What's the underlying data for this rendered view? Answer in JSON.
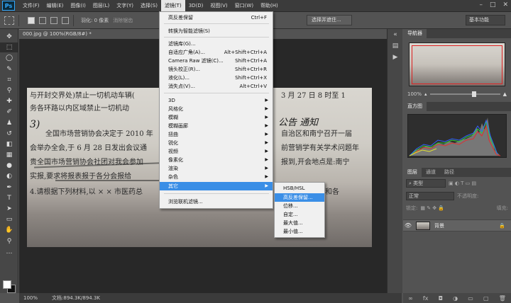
{
  "app": {
    "logo": "Ps"
  },
  "menubar": [
    "文件(F)",
    "编辑(E)",
    "图像(I)",
    "图层(L)",
    "文字(Y)",
    "选择(S)",
    "滤镜(T)",
    "3D(D)",
    "视图(V)",
    "窗口(W)",
    "帮助(H)"
  ],
  "options": {
    "feather": "羽化: 0 像素",
    "anti_alias": "消除锯齿",
    "select_and_mask": "选择并遮住...",
    "workspace": "基本功能"
  },
  "document": {
    "tab_title": "000.jpg @ 100%(RGB/8#) *",
    "zoom": "100%",
    "doc_info": "文档:894.3K/894.3K"
  },
  "canvas_text": {
    "l1": "与开封交界处)禁止一切机动车辆(",
    "l2": "务各环路以内区域禁止一切机动",
    "l3": "全国市场营销协会决定于 2010 年",
    "l4": "会举办全会,于 6 月 28 日发出会议通",
    "l5": "贵全国市场营销协会社团对我会参加",
    "l6": "实报,要求将报表报于各分会报给",
    "l7": "4.请根据下列材料,以 × × 市医药总",
    "r1": "3 月 27 日 8 时至 1",
    "r2": "自治区和南宁召开一届",
    "r3": "前营销学有关学术问题年",
    "r4": "报到,开会地点是:南宁",
    "r5": "各分公司和各",
    "hand1": "3)",
    "hand2": "公告 通知"
  },
  "filter_menu": {
    "items": [
      {
        "label": "高反差保留",
        "shortcut": "Ctrl+F"
      },
      {
        "label": "转换为智能滤镜(S)"
      },
      {
        "label": "滤镜库(G)..."
      },
      {
        "label": "自适应广角(A)...",
        "shortcut": "Alt+Shift+Ctrl+A"
      },
      {
        "label": "Camera Raw 滤镜(C)...",
        "shortcut": "Shift+Ctrl+A"
      },
      {
        "label": "镜头校正(R)...",
        "shortcut": "Shift+Ctrl+R"
      },
      {
        "label": "液化(L)...",
        "shortcut": "Shift+Ctrl+X"
      },
      {
        "label": "消失点(V)...",
        "shortcut": "Alt+Ctrl+V"
      },
      {
        "label": "3D"
      },
      {
        "label": "风格化"
      },
      {
        "label": "模糊"
      },
      {
        "label": "模糊画廊"
      },
      {
        "label": "扭曲"
      },
      {
        "label": "锐化"
      },
      {
        "label": "视频"
      },
      {
        "label": "像素化"
      },
      {
        "label": "渲染"
      },
      {
        "label": "杂色"
      },
      {
        "label": "其它"
      },
      {
        "label": "浏览联机滤镜..."
      }
    ]
  },
  "other_submenu": [
    "HSB/HSL",
    "高反差保留...",
    "位移...",
    "自定...",
    "最大值...",
    "最小值..."
  ],
  "panels": {
    "navigator_tab": "导航器",
    "histogram_tab": "直方图",
    "layer_tabs": [
      "图层",
      "通道",
      "路径"
    ],
    "kind_filter": "类型",
    "blend_mode": "正常",
    "opacity": "不透明度:",
    "lock": "锁定:",
    "fill": "填充:",
    "zoom": "100%",
    "layer_name": "背景"
  },
  "colors": {
    "accent": "#3a8ee6",
    "chrome": "#535353",
    "menubar": "#3b3b3b"
  }
}
